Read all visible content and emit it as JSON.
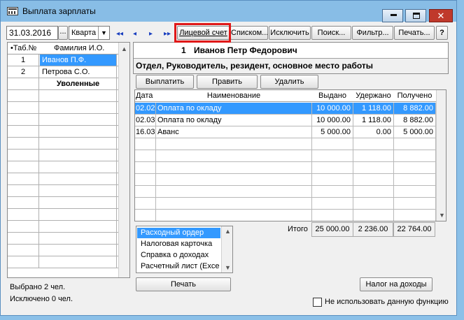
{
  "window": {
    "title": "Выплата зарплаты"
  },
  "toolbar": {
    "date_value": "31.03.2016",
    "period_selected": "Кварта",
    "personal_account": "Лицевой счет",
    "list": "Списком...",
    "exclude": "Исключить",
    "search": "Поиск...",
    "filter": "Фильтр...",
    "print": "Печать...",
    "help": "?"
  },
  "employees": {
    "headers": {
      "num": "•Таб.№",
      "name": "Фамилия И.О."
    },
    "rows": [
      {
        "num": "1",
        "name": "Иванов П.Ф."
      },
      {
        "num": "2",
        "name": "Петрова С.О."
      }
    ],
    "dismissed_label": "Уволенные"
  },
  "employee": {
    "num": "1",
    "name": "Иванов Петр Федорович",
    "department": "Отдел, Руководитель, резидент, основное место работы"
  },
  "actions": {
    "pay": "Выплатить",
    "edit": "Править",
    "delete": "Удалить"
  },
  "payments": {
    "headers": {
      "date": "Дата",
      "name": "Наименование",
      "paid": "Выдано",
      "withheld": "Удержано",
      "received": "Получено"
    },
    "rows": [
      {
        "date": "02.02",
        "name": "Оплата по окладу",
        "paid": "10 000.00",
        "withheld": "1 118.00",
        "received": "8 882.00"
      },
      {
        "date": "02.03",
        "name": "Оплата по окладу",
        "paid": "10 000.00",
        "withheld": "1 118.00",
        "received": "8 882.00"
      },
      {
        "date": "16.03",
        "name": "Аванс",
        "paid": "5 000.00",
        "withheld": "0.00",
        "received": "5 000.00"
      }
    ]
  },
  "totals": {
    "label": "Итого",
    "paid": "25 000.00",
    "withheld": "2 236.00",
    "received": "22 764.00"
  },
  "reports": {
    "items": [
      "Расходный ордер",
      "Налоговая карточка",
      "Справка о доходах",
      "Расчетный лист (Exce"
    ],
    "print_button": "Печать",
    "tax_button": "Налог на доходы"
  },
  "status": {
    "selected": "Выбрано 2 чел.",
    "excluded": "Исключено 0 чел.",
    "disable_function": "Не использовать данную функцию"
  },
  "colors": {
    "selection": "#3399ff",
    "titlebar": "#88bde6",
    "highlight_box": "#e01818"
  }
}
